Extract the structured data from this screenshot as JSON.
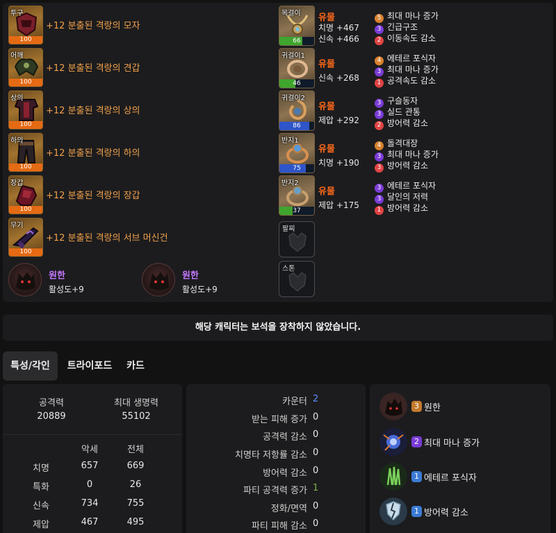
{
  "equipment": {
    "gear": [
      {
        "slot": "투구",
        "quality": "100",
        "name": "+12 분출된 격랑의 모자"
      },
      {
        "slot": "어깨",
        "quality": "100",
        "name": "+12 분출된 격랑의 견갑"
      },
      {
        "slot": "상의",
        "quality": "100",
        "name": "+12 분출된 격랑의 상의"
      },
      {
        "slot": "하의",
        "quality": "100",
        "name": "+12 분출된 격랑의 하의"
      },
      {
        "slot": "장갑",
        "quality": "100",
        "name": "+12 분출된 격랑의 장갑"
      },
      {
        "slot": "무기",
        "quality": "100",
        "name": "+12 분출된 격랑의 서브 머신건"
      }
    ],
    "ability_stones": [
      {
        "name": "원한",
        "stat": "활성도+9"
      },
      {
        "name": "원한",
        "stat": "활성도+9"
      }
    ],
    "accessories": [
      {
        "slot": "목걸이",
        "quality": 66,
        "grade": "유물",
        "stats": [
          "치명 +467",
          "신속 +466"
        ],
        "engravings": [
          {
            "lv": "5",
            "name": "최대 마나 증가",
            "color": "orange"
          },
          {
            "lv": "3",
            "name": "긴급구조",
            "color": "purple"
          },
          {
            "lv": "2",
            "name": "이동속도 감소",
            "color": "red"
          }
        ]
      },
      {
        "slot": "귀걸이1",
        "quality": 46,
        "grade": "유물",
        "stats": [
          "신속 +268"
        ],
        "engravings": [
          {
            "lv": "4",
            "name": "에테르 포식자",
            "color": "orange"
          },
          {
            "lv": "3",
            "name": "최대 마나 증가",
            "color": "purple"
          },
          {
            "lv": "1",
            "name": "공격속도 감소",
            "color": "red"
          }
        ]
      },
      {
        "slot": "귀걸이2",
        "quality": 86,
        "grade": "유물",
        "stats": [
          "제압 +292"
        ],
        "engravings": [
          {
            "lv": "3",
            "name": "구슬동자",
            "color": "purple"
          },
          {
            "lv": "3",
            "name": "실드 관통",
            "color": "purple"
          },
          {
            "lv": "2",
            "name": "방어력 감소",
            "color": "red"
          }
        ]
      },
      {
        "slot": "반지1",
        "quality": 75,
        "grade": "유물",
        "stats": [
          "치명 +190"
        ],
        "engravings": [
          {
            "lv": "4",
            "name": "돌격대장",
            "color": "orange"
          },
          {
            "lv": "3",
            "name": "최대 마나 증가",
            "color": "purple"
          },
          {
            "lv": "3",
            "name": "방어력 감소",
            "color": "red"
          }
        ]
      },
      {
        "slot": "반지2",
        "quality": 37,
        "grade": "유물",
        "stats": [
          "제압 +175"
        ],
        "engravings": [
          {
            "lv": "3",
            "name": "에테르 포식자",
            "color": "purple"
          },
          {
            "lv": "3",
            "name": "달인의 저력",
            "color": "purple"
          },
          {
            "lv": "1",
            "name": "방어력 감소",
            "color": "red"
          }
        ]
      }
    ],
    "empty_slots": [
      {
        "slot": "팔찌"
      },
      {
        "slot": "스톤"
      }
    ]
  },
  "gem_notice": "해당 캐릭터는 보석을 장착하지 않았습니다.",
  "tabs": [
    {
      "label": "특성/각인",
      "active": true
    },
    {
      "label": "트라이포드",
      "active": false
    },
    {
      "label": "카드",
      "active": false
    }
  ],
  "stats": {
    "attack_label": "공격력",
    "attack_value": "20889",
    "hp_label": "최대 생명력",
    "hp_value": "55102",
    "col_headers": [
      "악세",
      "전체"
    ],
    "rows": [
      {
        "name": "치명",
        "accessory": "657",
        "total": "669"
      },
      {
        "name": "특화",
        "accessory": "0",
        "total": "26"
      },
      {
        "name": "신속",
        "accessory": "734",
        "total": "755"
      },
      {
        "name": "제압",
        "accessory": "467",
        "total": "495"
      }
    ]
  },
  "extra_stats": [
    {
      "label": "카운터",
      "value": "2",
      "color": "blue"
    },
    {
      "label": "받는 피해 증가",
      "value": "0",
      "color": ""
    },
    {
      "label": "공격력 감소",
      "value": "0",
      "color": ""
    },
    {
      "label": "치명타 저항률 감소",
      "value": "0",
      "color": ""
    },
    {
      "label": "방어력 감소",
      "value": "0",
      "color": ""
    },
    {
      "label": "파티 공격력 증가",
      "value": "1",
      "color": "green"
    },
    {
      "label": "정화/면역",
      "value": "0",
      "color": ""
    },
    {
      "label": "파티 피해 감소",
      "value": "0",
      "color": ""
    }
  ],
  "active_engravings": [
    {
      "lv": "3",
      "name": "원한",
      "color": "orange",
      "icon": "beast-icon"
    },
    {
      "lv": "2",
      "name": "최대 마나 증가",
      "color": "purple",
      "icon": "mana-orb-icon"
    },
    {
      "lv": "1",
      "name": "에테르 포식자",
      "color": "blue",
      "icon": "ether-claw-icon"
    },
    {
      "lv": "1",
      "name": "방어력 감소",
      "color": "blue",
      "icon": "broken-shield-icon"
    }
  ]
}
